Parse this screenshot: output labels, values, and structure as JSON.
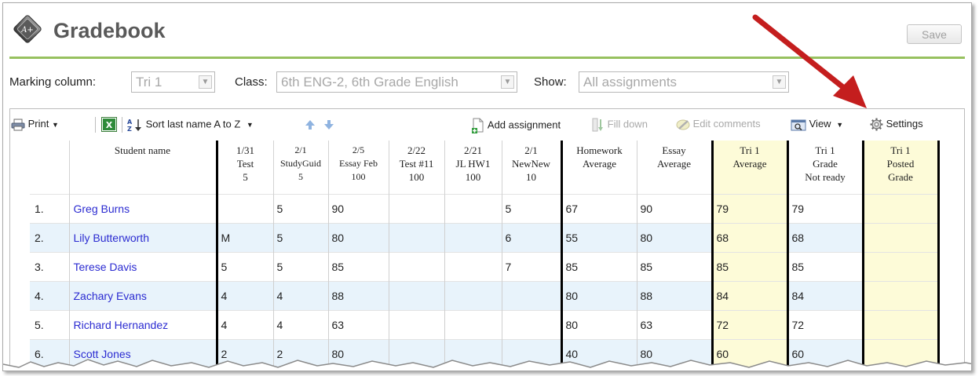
{
  "header": {
    "title": "Gradebook",
    "save_label": "Save"
  },
  "filters": {
    "marking_label": "Marking column:",
    "marking_value": "Tri 1",
    "class_label": "Class:",
    "class_value": "6th ENG-2, 6th Grade English",
    "show_label": "Show:",
    "show_value": "All assignments"
  },
  "toolbar": {
    "print": "Print",
    "sort": "Sort last name A to Z",
    "add_assignment": "Add assignment",
    "fill_down": "Fill down",
    "edit_comments": "Edit comments",
    "view": "View",
    "settings": "Settings"
  },
  "columns": {
    "student": "Student name",
    "a1": [
      "1/31",
      "Test",
      "5"
    ],
    "a2": [
      "2/1",
      "StudyGuid",
      "5"
    ],
    "a3": [
      "2/5",
      "Essay Feb",
      "100"
    ],
    "a4": [
      "2/22",
      "Test #11",
      "100"
    ],
    "a5": [
      "2/21",
      "JL HW1",
      "100"
    ],
    "a6": [
      "2/1",
      "NewNew",
      "10"
    ],
    "hw": [
      "Homework",
      "Average"
    ],
    "essay": [
      "Essay",
      "Average"
    ],
    "tri_avg": [
      "Tri 1",
      "Average"
    ],
    "tri_grade": [
      "Tri 1",
      "Grade",
      "Not ready"
    ],
    "tri_posted": [
      "Tri 1",
      "Posted",
      "Grade"
    ]
  },
  "rows": [
    {
      "n": "1.",
      "name": "Greg Burns",
      "a1": "",
      "a2": "5",
      "a3": "90",
      "a4": "",
      "a5": "",
      "a6": "5",
      "hw": "67",
      "essay": "90",
      "tri_avg": "79",
      "tri_grade": "79",
      "posted": ""
    },
    {
      "n": "2.",
      "name": "Lily Butterworth",
      "a1": "M",
      "a2": "5",
      "a3": "80",
      "a4": "",
      "a5": "",
      "a6": "6",
      "hw": "55",
      "essay": "80",
      "tri_avg": "68",
      "tri_grade": "68",
      "posted": ""
    },
    {
      "n": "3.",
      "name": "Terese Davis",
      "a1": "5",
      "a2": "5",
      "a3": "85",
      "a4": "",
      "a5": "",
      "a6": "7",
      "hw": "85",
      "essay": "85",
      "tri_avg": "85",
      "tri_grade": "85",
      "posted": ""
    },
    {
      "n": "4.",
      "name": "Zachary Evans",
      "a1": "4",
      "a2": "4",
      "a3": "88",
      "a4": "",
      "a5": "",
      "a6": "",
      "hw": "80",
      "essay": "88",
      "tri_avg": "84",
      "tri_grade": "84",
      "posted": ""
    },
    {
      "n": "5.",
      "name": "Richard Hernandez",
      "a1": "4",
      "a2": "4",
      "a3": "63",
      "a4": "",
      "a5": "",
      "a6": "",
      "hw": "80",
      "essay": "63",
      "tri_avg": "72",
      "tri_grade": "72",
      "posted": ""
    },
    {
      "n": "6.",
      "name": "Scott Jones",
      "a1": "2",
      "a2": "2",
      "a3": "80",
      "a4": "",
      "a5": "",
      "a6": "",
      "hw": "40",
      "essay": "80",
      "tri_avg": "60",
      "tri_grade": "60",
      "posted": ""
    }
  ],
  "colors": {
    "accent_green": "#97c15f",
    "link_blue": "#2b2bd1",
    "row_alt": "#e8f3fb",
    "grade_yellow": "#fdfbd8",
    "arrow_red": "#c41e1e"
  }
}
